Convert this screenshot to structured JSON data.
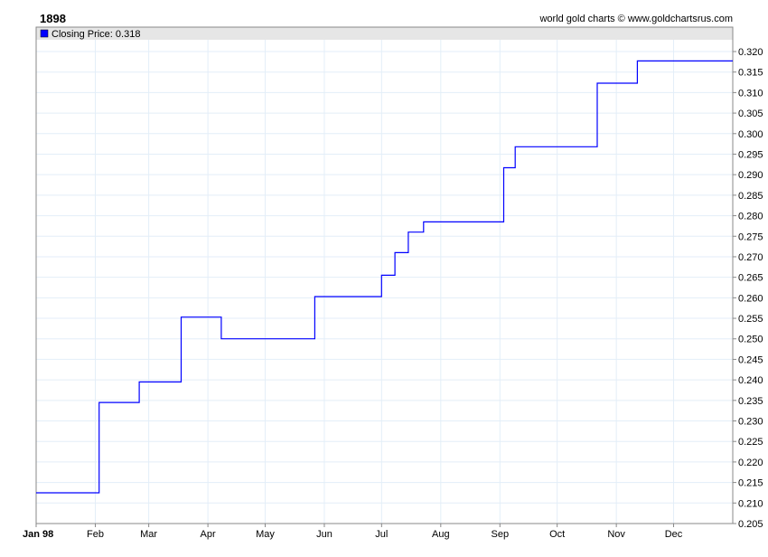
{
  "chart_data": {
    "type": "line",
    "title": "1898",
    "credit": "world gold charts © www.goldchartsrus.com",
    "legend": {
      "label": "Closing Price: 0.318",
      "color": "#0000ff",
      "placement": "top-left"
    },
    "x_ticks": [
      {
        "label": "Jan 98",
        "day": 0
      },
      {
        "label": "Feb",
        "day": 31
      },
      {
        "label": "Mar",
        "day": 59
      },
      {
        "label": "Apr",
        "day": 90
      },
      {
        "label": "May",
        "day": 120
      },
      {
        "label": "Jun",
        "day": 151
      },
      {
        "label": "Jul",
        "day": 181
      },
      {
        "label": "Aug",
        "day": 212
      },
      {
        "label": "Sep",
        "day": 243
      },
      {
        "label": "Oct",
        "day": 273
      },
      {
        "label": "Nov",
        "day": 304
      },
      {
        "label": "Dec",
        "day": 334
      }
    ],
    "xlim": [
      0,
      365
    ],
    "ylim": [
      0.205,
      0.3225
    ],
    "y_ticks": [
      0.205,
      0.21,
      0.215,
      0.22,
      0.225,
      0.23,
      0.235,
      0.24,
      0.245,
      0.25,
      0.255,
      0.26,
      0.265,
      0.27,
      0.275,
      0.28,
      0.285,
      0.29,
      0.295,
      0.3,
      0.305,
      0.31,
      0.315,
      0.32
    ],
    "grid": true,
    "series": [
      {
        "name": "Closing Price",
        "step": true,
        "points": [
          [
            0,
            0.2125
          ],
          [
            33,
            0.2345
          ],
          [
            54,
            0.2395
          ],
          [
            76,
            0.2553
          ],
          [
            97,
            0.25
          ],
          [
            146,
            0.2603
          ],
          [
            181,
            0.2655
          ],
          [
            188,
            0.271
          ],
          [
            195,
            0.276
          ],
          [
            203,
            0.2785
          ],
          [
            245,
            0.2917
          ],
          [
            251,
            0.2968
          ],
          [
            294,
            0.3123
          ],
          [
            315,
            0.3177
          ],
          [
            365,
            0.3177
          ]
        ]
      }
    ]
  }
}
